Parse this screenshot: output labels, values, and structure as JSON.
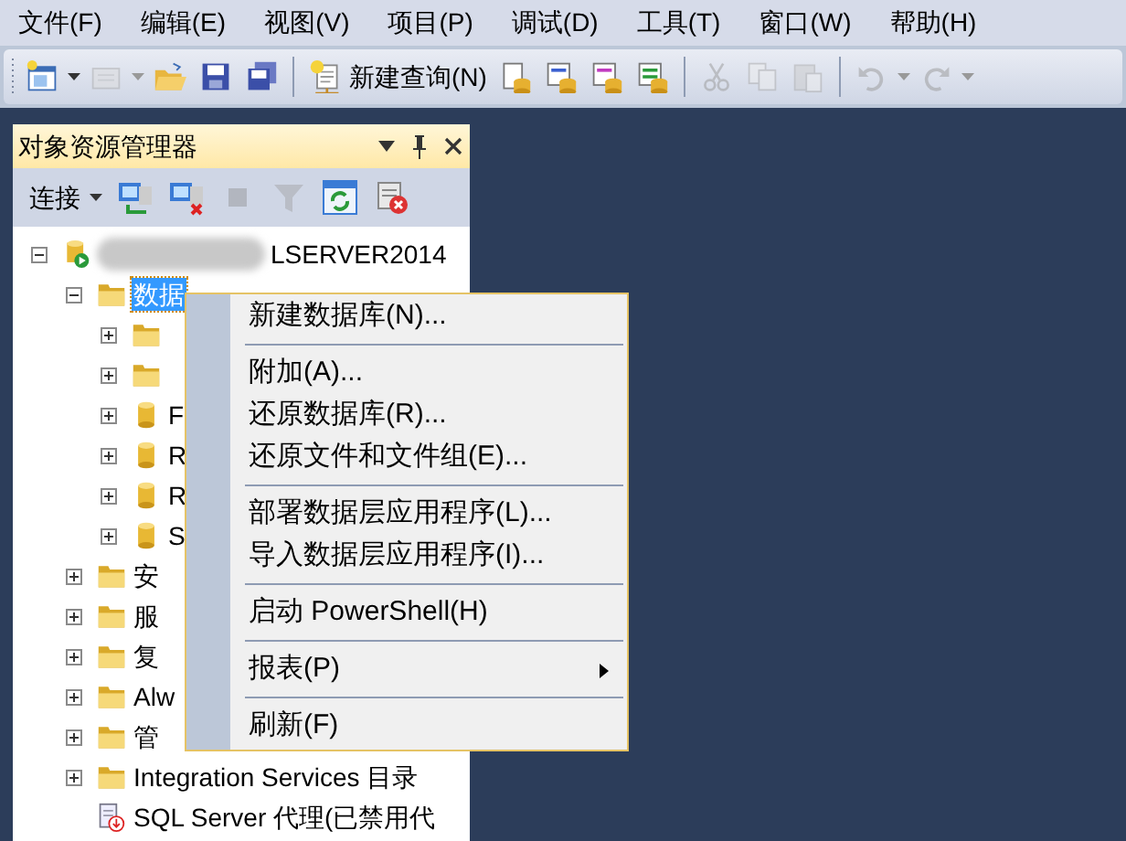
{
  "menu_bar": [
    "文件(F)",
    "编辑(E)",
    "视图(V)",
    "项目(P)",
    "调试(D)",
    "工具(T)",
    "窗口(W)",
    "帮助(H)"
  ],
  "toolbar": [
    {
      "disabled": false,
      "dropdown": true
    },
    {
      "disabled": true,
      "dropdown": true
    },
    {
      "disabled": false
    },
    {
      "disabled": false
    },
    {
      "disabled": false
    },
    {
      "kind": "separator"
    },
    {
      "disabled": false,
      "label": "新建查询(N)"
    },
    {
      "disabled": false
    },
    {
      "disabled": false
    },
    {
      "disabled": false
    },
    {
      "disabled": false
    },
    {
      "kind": "separator"
    },
    {
      "disabled": true
    },
    {
      "disabled": true
    },
    {
      "disabled": true
    },
    {
      "kind": "separator"
    },
    {
      "disabled": true,
      "dropdown": true
    },
    {
      "disabled": true,
      "dropdown": true
    }
  ],
  "object_explorer": {
    "title": "对象资源管理器",
    "toolbar": [
      {
        "label": "连接",
        "disabled": false,
        "dropdown": true
      },
      {
        "disabled": false
      },
      {
        "disabled": false
      },
      {
        "disabled": true
      },
      {
        "disabled": true
      },
      {
        "disabled": false
      },
      {
        "disabled": false
      }
    ],
    "tree": [
      {
        "kind": "server",
        "label": "LSERVER2014",
        "redacted": true,
        "expanded": true,
        "selected": false,
        "children": [
          {
            "kind": "folder",
            "label": "数据",
            "expanded": true,
            "selected": true,
            "children": [
              {
                "kind": "folder",
                "expanded": false
              },
              {
                "kind": "folder",
                "expanded": false
              },
              {
                "kind": "database",
                "label": "F",
                "expanded": false,
                "selected": false
              },
              {
                "kind": "database",
                "label": "R",
                "expanded": false,
                "selected": false
              },
              {
                "kind": "database",
                "label": "R",
                "expanded": false,
                "selected": false
              },
              {
                "kind": "database",
                "label": "S",
                "expanded": false,
                "selected": false
              }
            ]
          },
          {
            "kind": "folder",
            "label": "安",
            "expanded": false,
            "selected": false
          },
          {
            "kind": "folder",
            "label": "服",
            "expanded": false,
            "selected": false
          },
          {
            "kind": "folder",
            "label": "复",
            "expanded": false,
            "selected": false
          },
          {
            "kind": "folder",
            "label": "Alw",
            "expanded": false,
            "selected": false
          },
          {
            "kind": "folder",
            "label": "管",
            "expanded": false,
            "selected": false
          },
          {
            "kind": "folder",
            "label": "Integration Services 目录",
            "expanded": false,
            "selected": false
          },
          {
            "kind": "agent",
            "label": "SQL Server 代理(已禁用代",
            "selected": false
          }
        ]
      }
    ]
  },
  "context_menu": [
    {
      "kind": "item",
      "label": "新建数据库(N)..."
    },
    {
      "kind": "separator"
    },
    {
      "kind": "item",
      "label": "附加(A)..."
    },
    {
      "kind": "item",
      "label": "还原数据库(R)..."
    },
    {
      "kind": "item",
      "label": "还原文件和文件组(E)..."
    },
    {
      "kind": "separator"
    },
    {
      "kind": "item",
      "label": "部署数据层应用程序(L)..."
    },
    {
      "kind": "item",
      "label": "导入数据层应用程序(I)..."
    },
    {
      "kind": "separator"
    },
    {
      "kind": "item",
      "label": "启动 PowerShell(H)"
    },
    {
      "kind": "separator"
    },
    {
      "kind": "item",
      "label": "报表(P)",
      "submenu": true
    },
    {
      "kind": "separator"
    },
    {
      "kind": "item",
      "label": "刷新(F)"
    }
  ]
}
